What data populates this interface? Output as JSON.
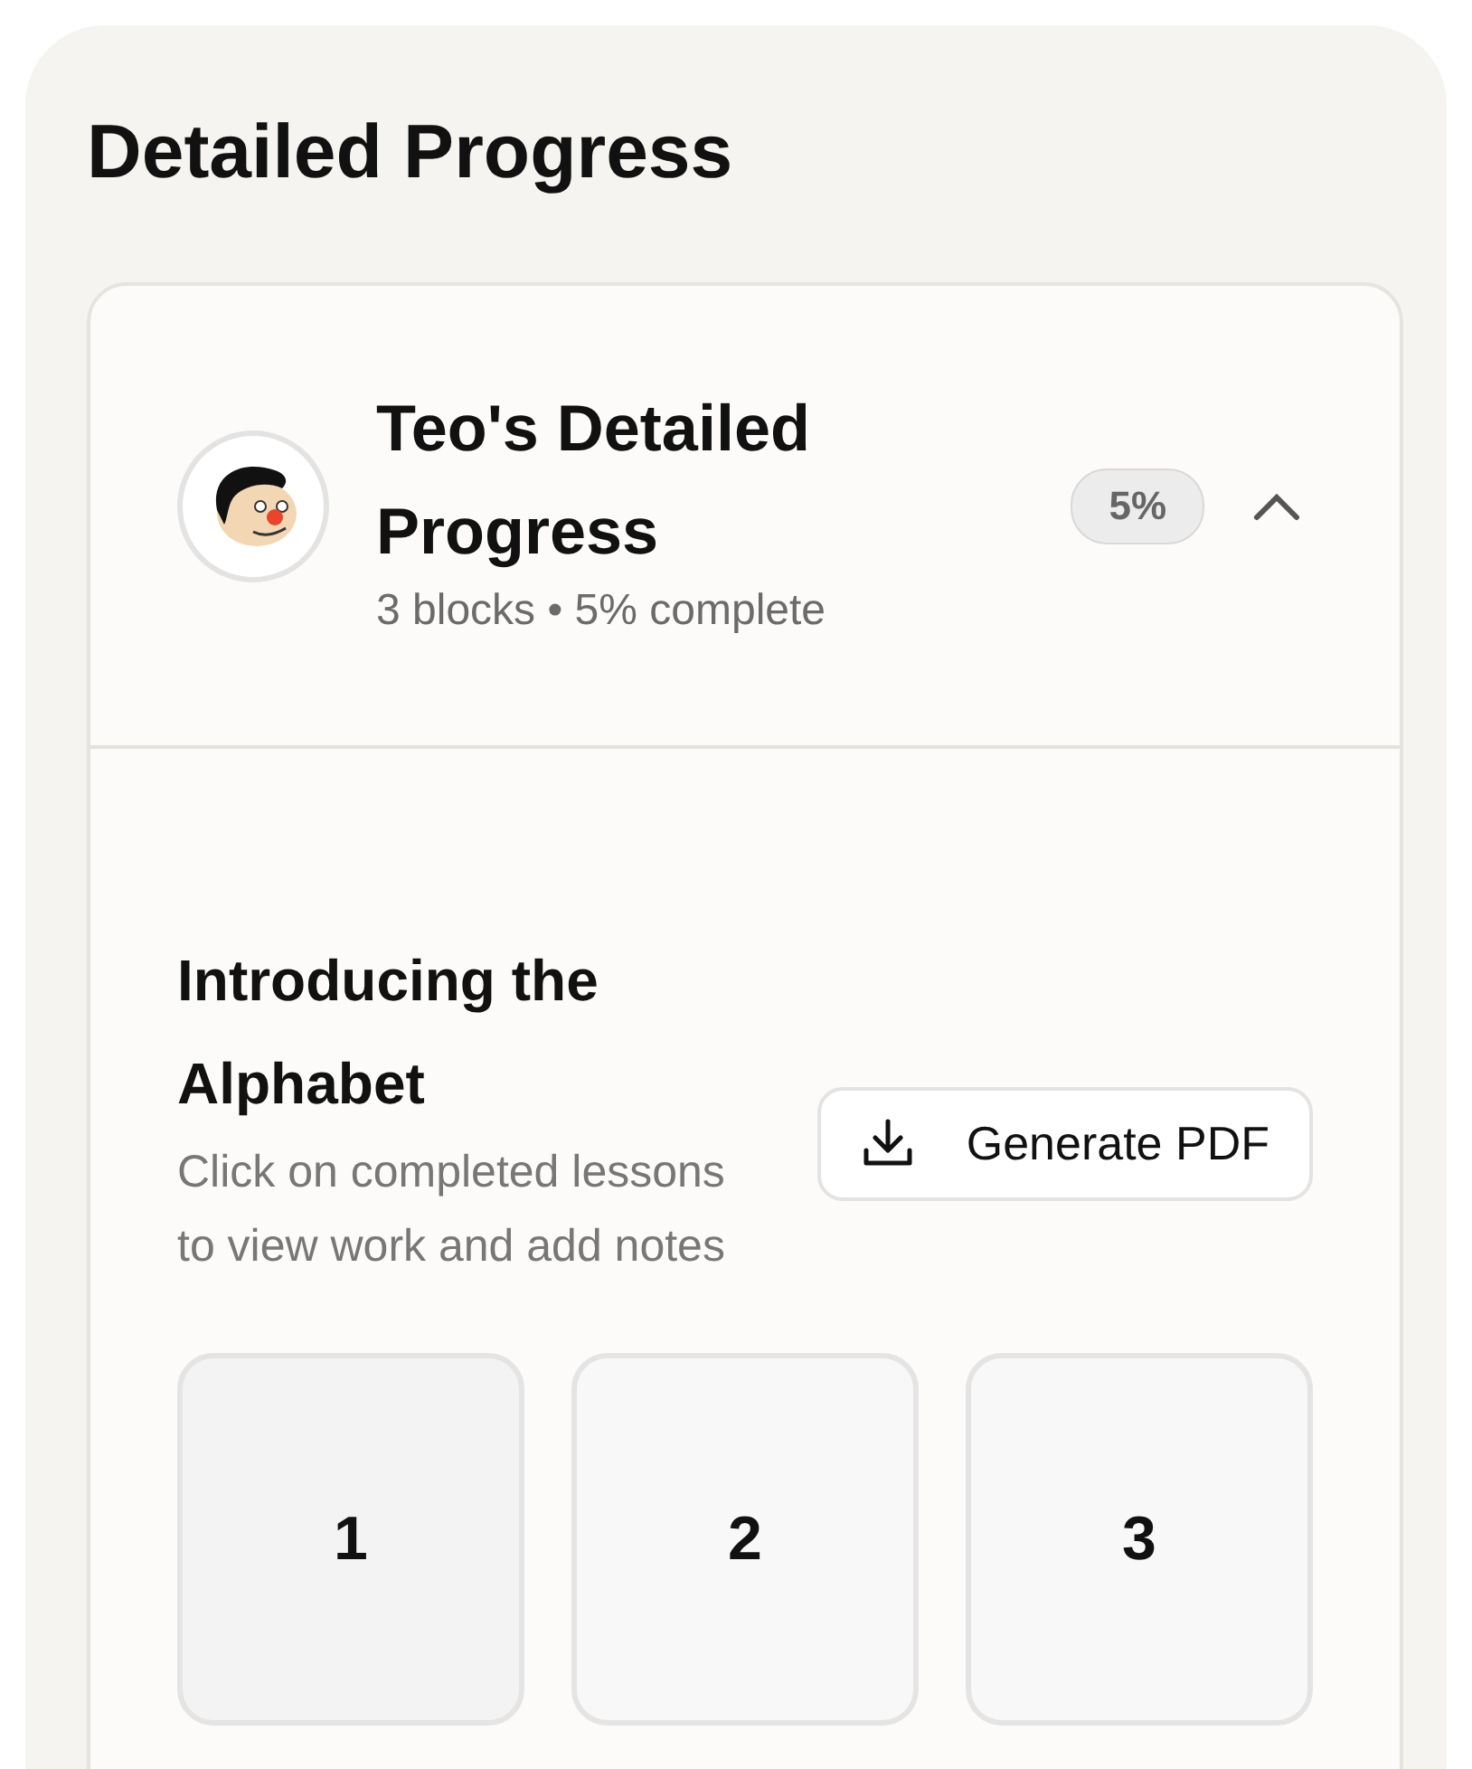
{
  "page": {
    "title": "Detailed Progress"
  },
  "student": {
    "title": "Teo's Detailed Progress",
    "subtitle": "3 blocks • 5% complete",
    "badge": "5%",
    "expanded": true
  },
  "block": {
    "title": "Introducing the Alphabet",
    "description": "Click on completed lessons to view work and add notes",
    "button": "Generate PDF"
  },
  "lessons": [
    {
      "label": "1",
      "selected": true
    },
    {
      "label": "2",
      "selected": false
    },
    {
      "label": "3",
      "selected": false
    }
  ]
}
